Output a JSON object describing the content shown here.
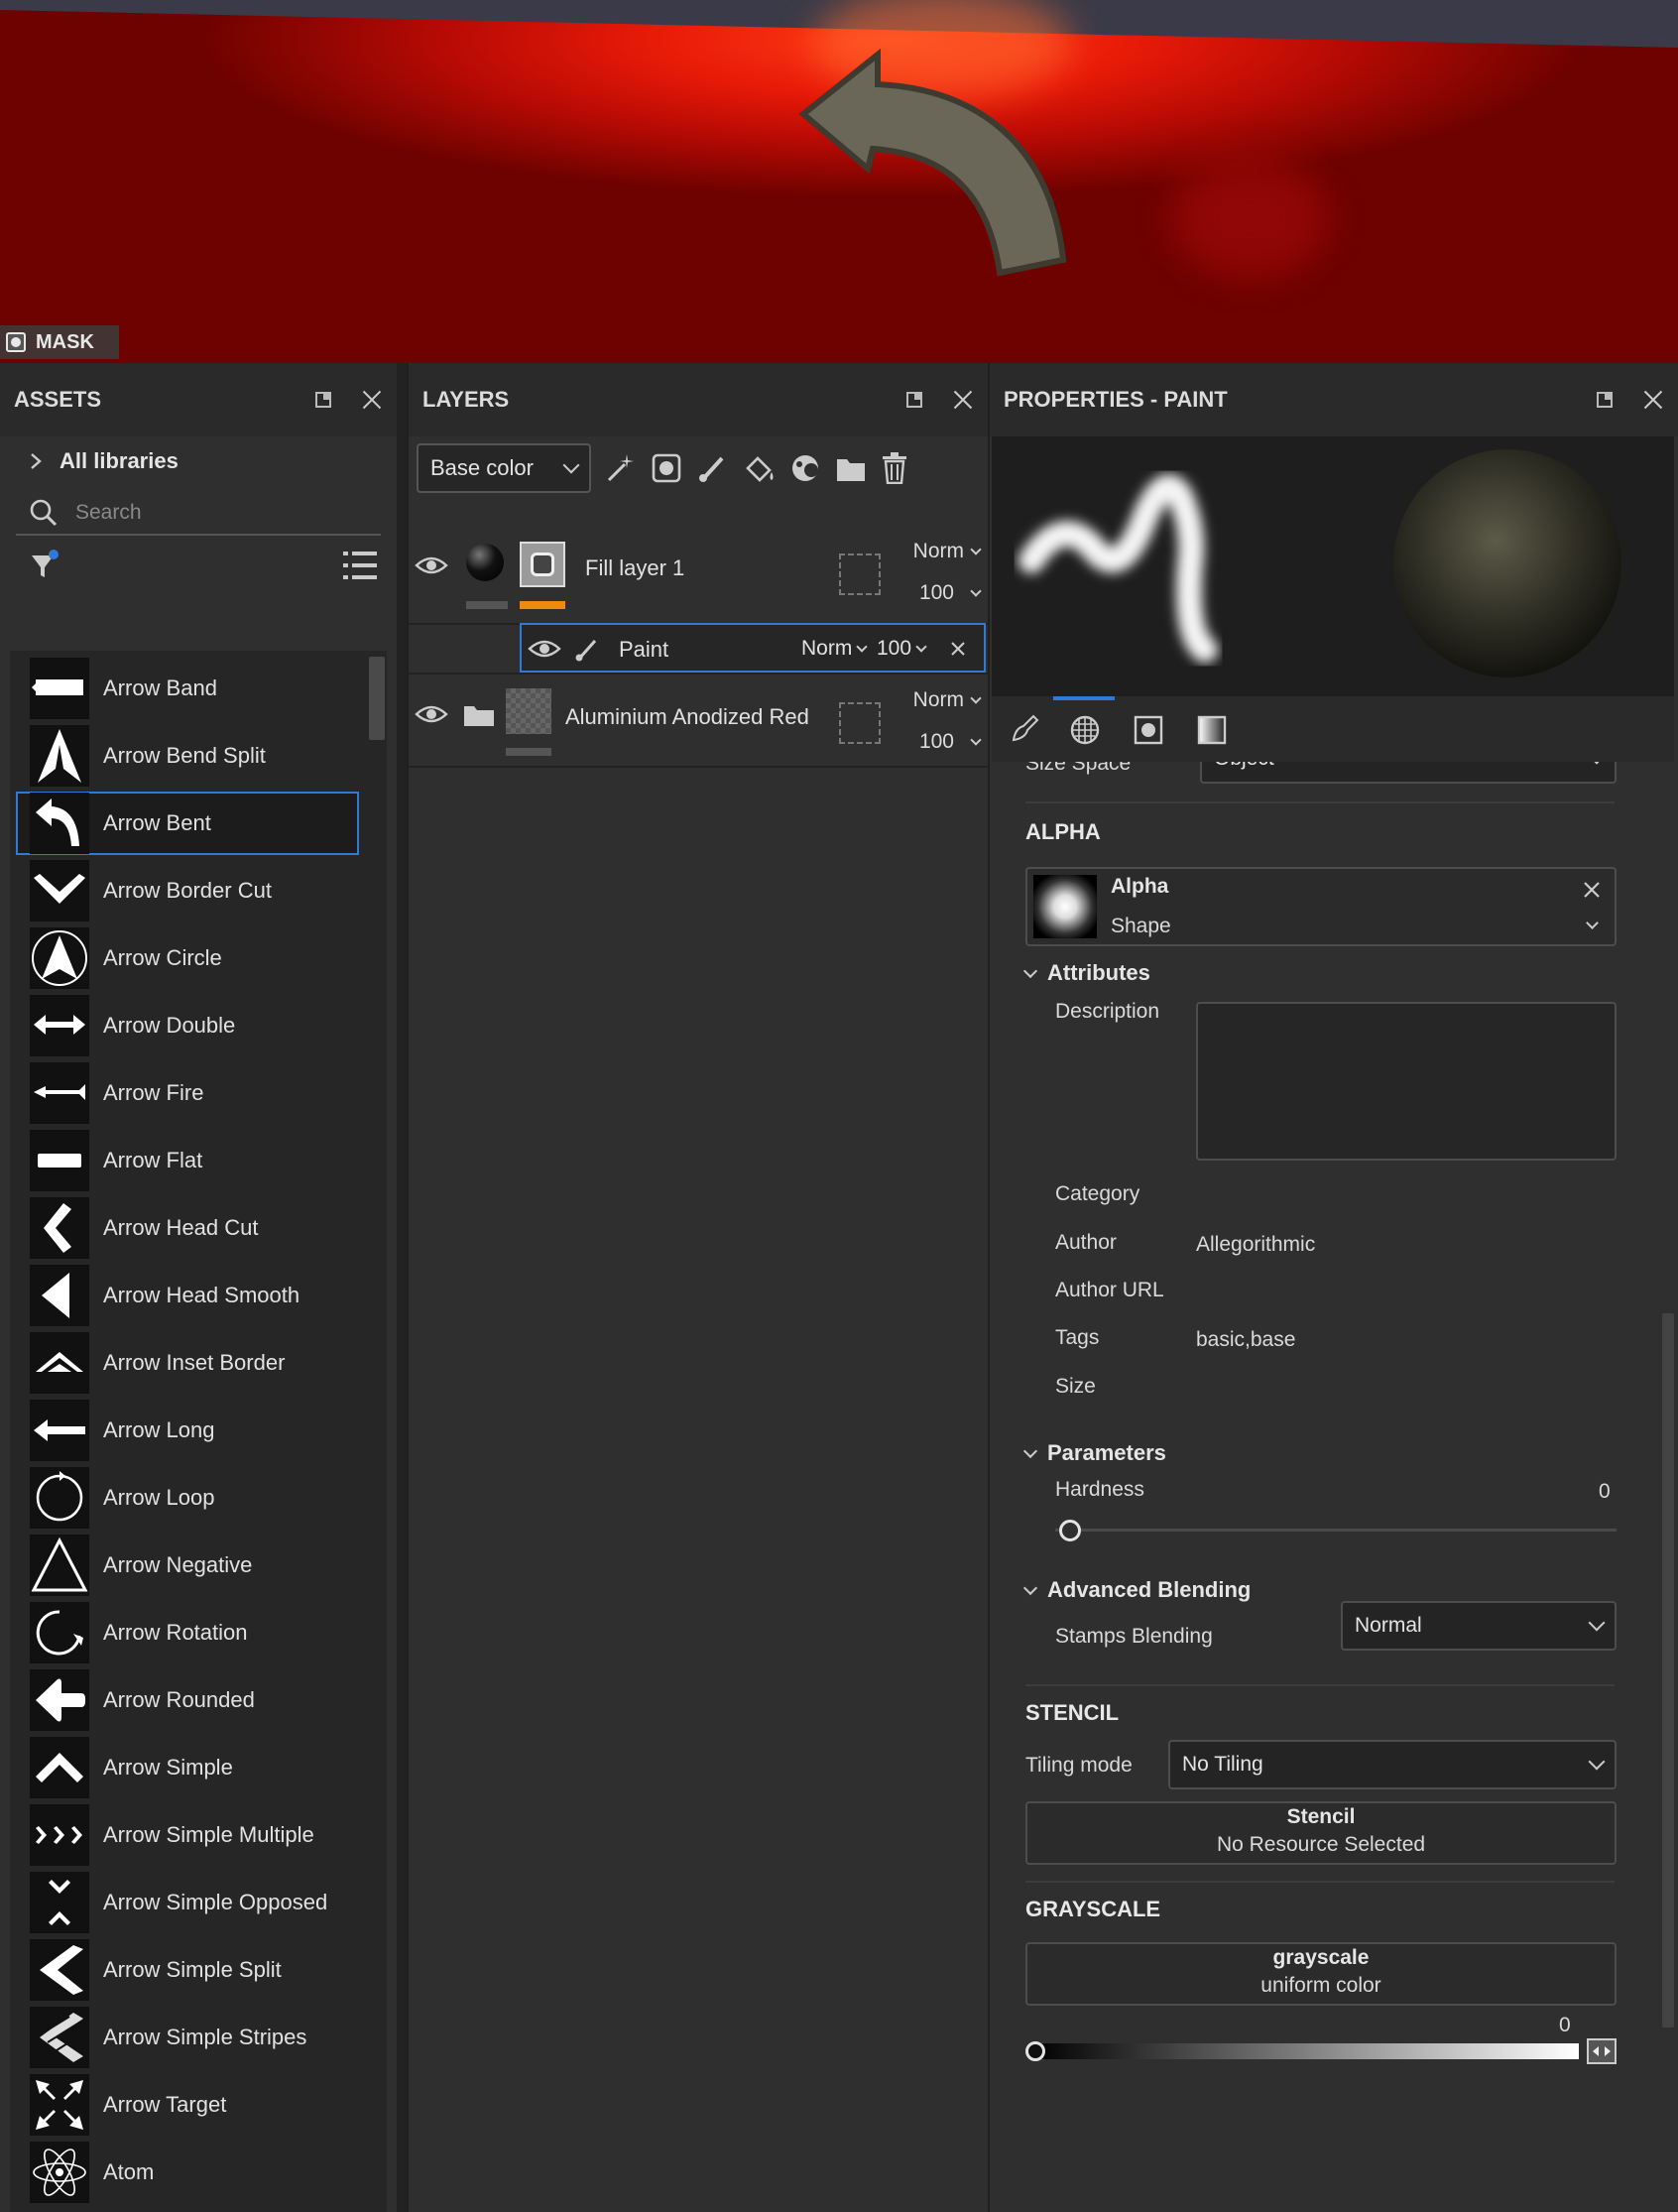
{
  "viewport": {
    "mask_label": "MASK"
  },
  "assets": {
    "title": "ASSETS",
    "libraries_label": "All libraries",
    "search_placeholder": "Search",
    "items": [
      {
        "label": "Arrow Band",
        "icon": "arrow-band-icon"
      },
      {
        "label": "Arrow Bend Split",
        "icon": "arrow-bend-split-icon"
      },
      {
        "label": "Arrow Bent",
        "icon": "arrow-bent-icon",
        "selected": true
      },
      {
        "label": "Arrow Border Cut",
        "icon": "arrow-border-cut-icon"
      },
      {
        "label": "Arrow Circle",
        "icon": "arrow-circle-icon"
      },
      {
        "label": "Arrow Double",
        "icon": "arrow-double-icon"
      },
      {
        "label": "Arrow Fire",
        "icon": "arrow-fire-icon"
      },
      {
        "label": "Arrow Flat",
        "icon": "arrow-flat-icon"
      },
      {
        "label": "Arrow Head Cut",
        "icon": "arrow-head-cut-icon"
      },
      {
        "label": "Arrow Head Smooth",
        "icon": "arrow-head-smooth-icon"
      },
      {
        "label": "Arrow Inset Border",
        "icon": "arrow-inset-border-icon"
      },
      {
        "label": "Arrow Long",
        "icon": "arrow-long-icon"
      },
      {
        "label": "Arrow Loop",
        "icon": "arrow-loop-icon"
      },
      {
        "label": "Arrow Negative",
        "icon": "arrow-negative-icon"
      },
      {
        "label": "Arrow Rotation",
        "icon": "arrow-rotation-icon"
      },
      {
        "label": "Arrow Rounded",
        "icon": "arrow-rounded-icon"
      },
      {
        "label": "Arrow Simple",
        "icon": "arrow-simple-icon"
      },
      {
        "label": "Arrow Simple Multiple",
        "icon": "arrow-simple-multiple-icon"
      },
      {
        "label": "Arrow Simple Opposed",
        "icon": "arrow-simple-opposed-icon"
      },
      {
        "label": "Arrow Simple Split",
        "icon": "arrow-simple-split-icon"
      },
      {
        "label": "Arrow Simple Stripes",
        "icon": "arrow-simple-stripes-icon"
      },
      {
        "label": "Arrow Target",
        "icon": "arrow-target-icon"
      },
      {
        "label": "Atom",
        "icon": "atom-icon"
      }
    ]
  },
  "layers": {
    "title": "LAYERS",
    "channel_select": "Base color",
    "rows": {
      "fill": {
        "name": "Fill layer 1",
        "blend": "Norm",
        "opacity": "100"
      },
      "paint": {
        "name": "Paint",
        "blend": "Norm",
        "opacity": "100"
      },
      "folder": {
        "name": "Aluminium Anodized Red",
        "blend": "Norm",
        "opacity": "100"
      }
    }
  },
  "properties": {
    "title": "PROPERTIES - PAINT",
    "size_space": {
      "label": "Size Space",
      "value": "Object"
    },
    "alpha": {
      "section": "ALPHA",
      "resource_name": "Alpha",
      "resource_type": "Shape",
      "attributes_label": "Attributes",
      "description_label": "Description",
      "category_label": "Category",
      "author_label": "Author",
      "author_value": "Allegorithmic",
      "author_url_label": "Author URL",
      "tags_label": "Tags",
      "tags_value": "basic,base",
      "size_label": "Size",
      "parameters_label": "Parameters",
      "hardness_label": "Hardness",
      "hardness_value": "0",
      "hardness_fraction": 0,
      "advanced_label": "Advanced Blending",
      "stamps_label": "Stamps Blending",
      "stamps_value": "Normal"
    },
    "stencil": {
      "section": "STENCIL",
      "tiling_label": "Tiling mode",
      "tiling_value": "No Tiling",
      "btn_title": "Stencil",
      "btn_sub": "No Resource Selected"
    },
    "grayscale": {
      "section": "GRAYSCALE",
      "btn_title": "grayscale",
      "btn_sub": "uniform color",
      "value": "0",
      "fraction": 0
    }
  },
  "colors": {
    "accent": "#2f7ad6",
    "layer_color_tag": "#f08a0c"
  }
}
